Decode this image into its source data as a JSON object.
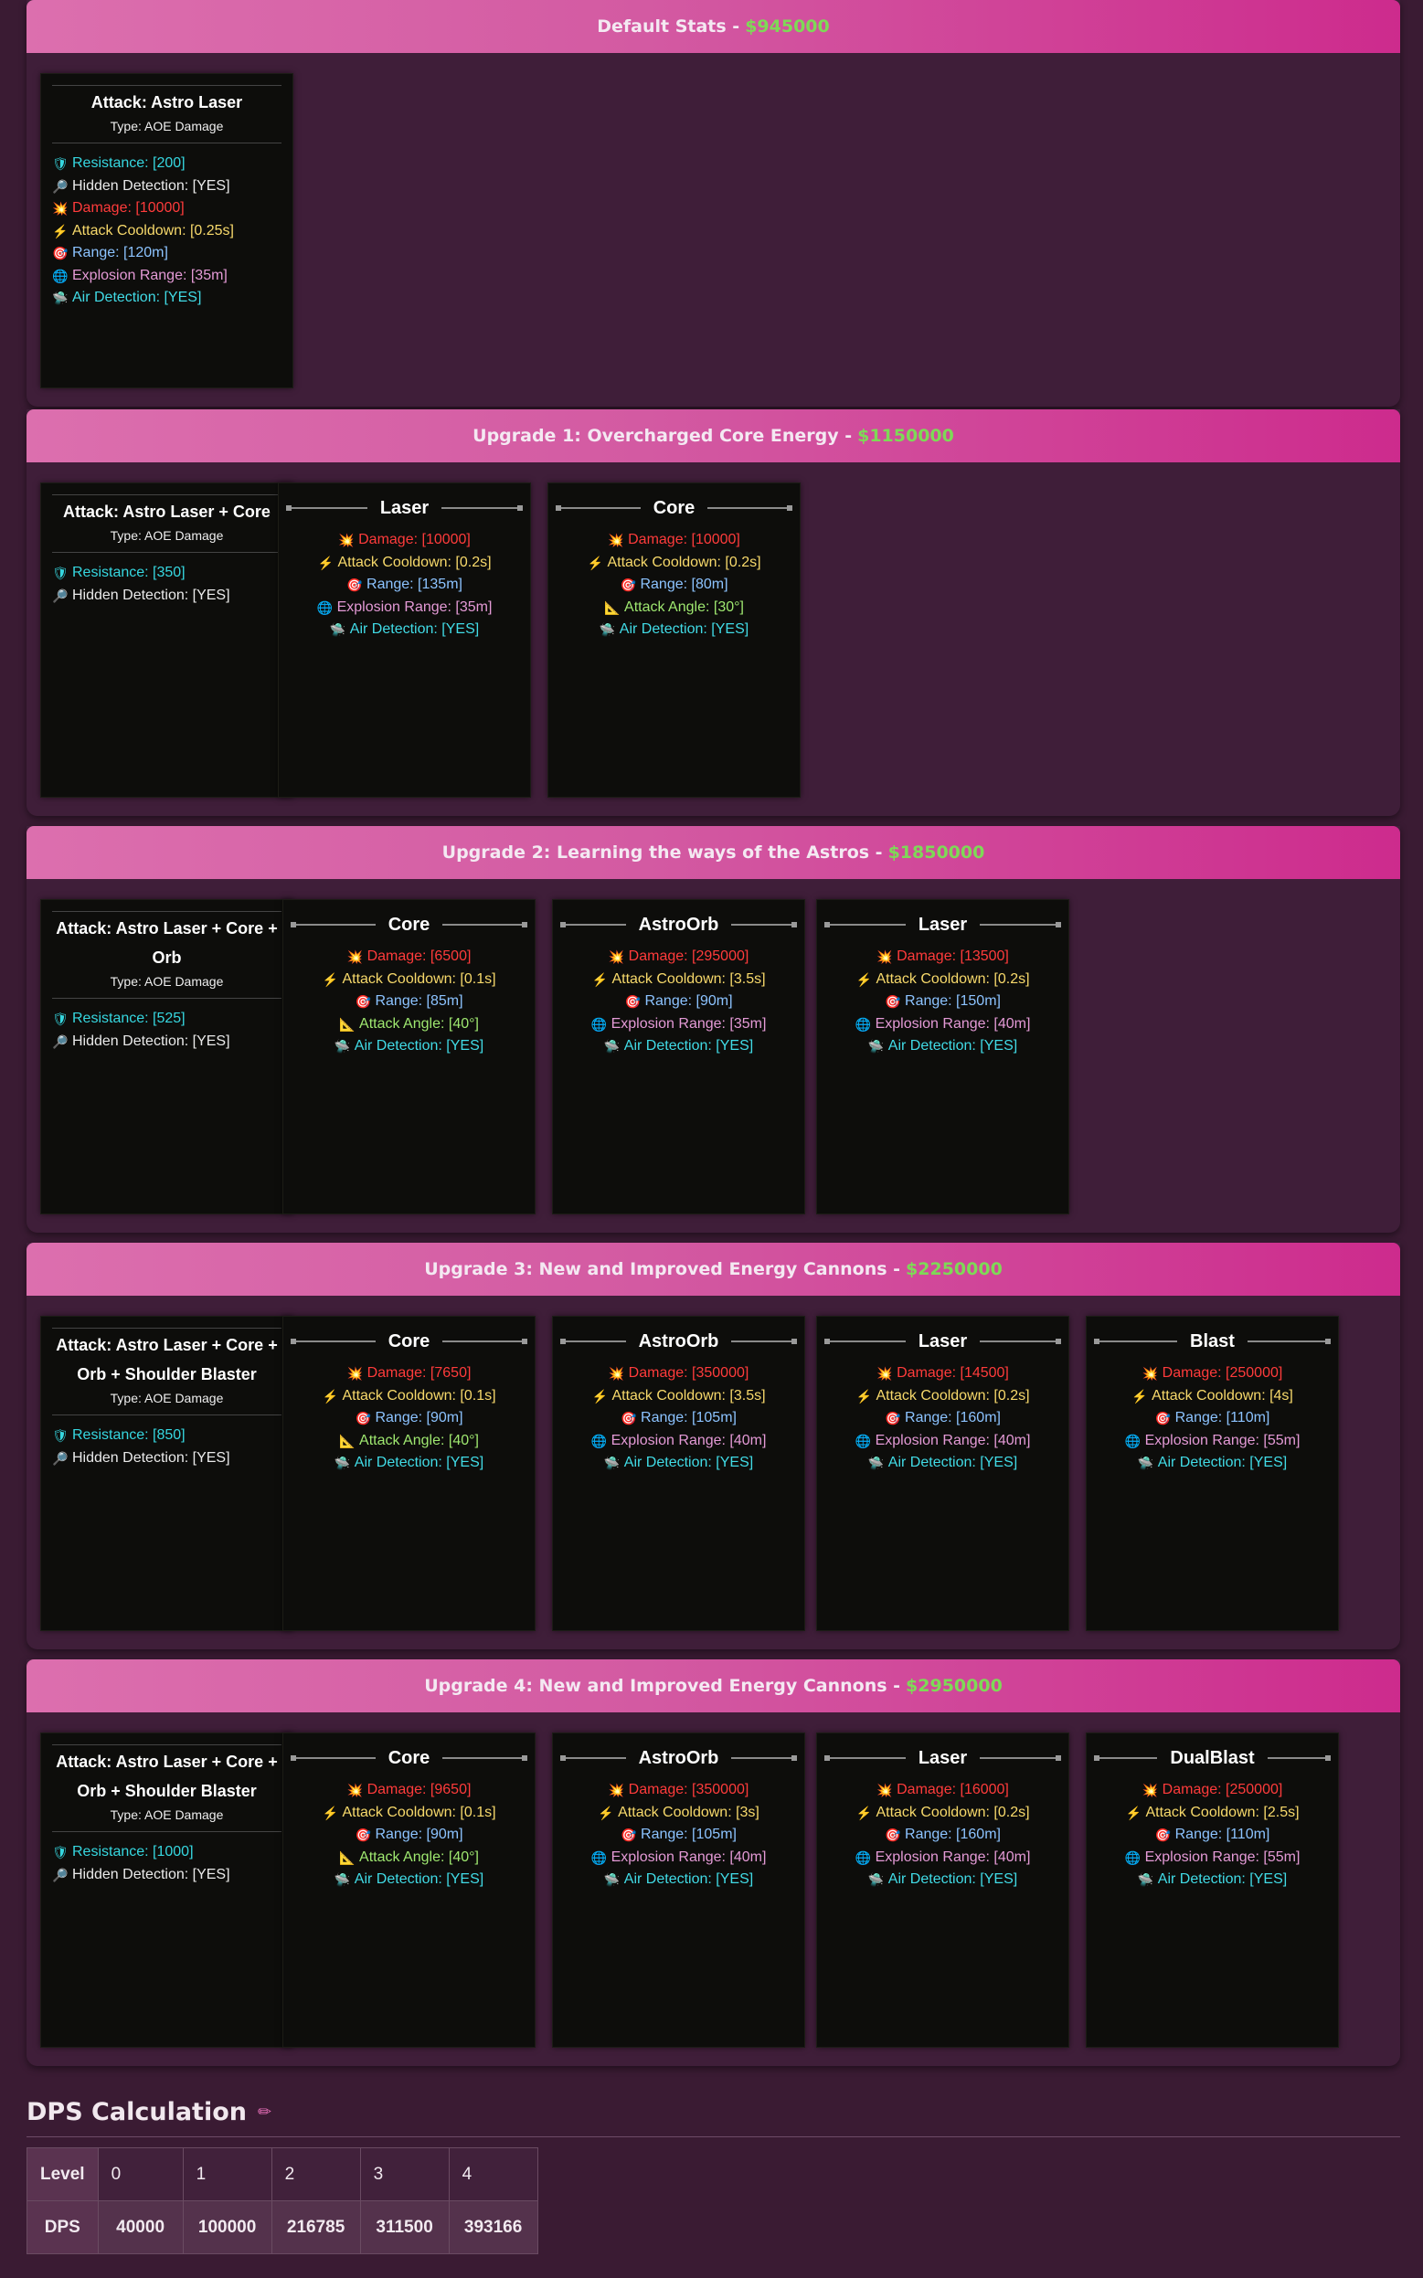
{
  "sections": [
    {
      "title": "Default Stats - ",
      "price": "$945000",
      "main": {
        "title": "Attack: Astro Laser",
        "type": "Type: AOE Damage",
        "stats": [
          {
            "icon": "shield-icon",
            "glyph": "🛡",
            "cls": "c-res",
            "text": "Resistance: [200]"
          },
          {
            "icon": "magnifier-icon",
            "glyph": "🔎",
            "cls": "c-hid",
            "text": "Hidden Detection: [YES]"
          },
          {
            "icon": "explosion-icon",
            "glyph": "💥",
            "cls": "c-dmg",
            "text": "Damage: [10000]"
          },
          {
            "icon": "lightning-icon",
            "glyph": "⚡",
            "cls": "c-cd",
            "text": "Attack Cooldown: [0.25s]"
          },
          {
            "icon": "target-icon",
            "glyph": "🎯",
            "cls": "c-rng",
            "text": "Range: [120m]"
          },
          {
            "icon": "globe-icon",
            "glyph": "🌐",
            "cls": "c-exp",
            "text": "Explosion Range: [35m]"
          },
          {
            "icon": "ufo-icon",
            "glyph": "🛸",
            "cls": "c-air",
            "text": "Air Detection: [YES]"
          }
        ]
      },
      "subs": []
    },
    {
      "title": "Upgrade 1: Overcharged Core Energy - ",
      "price": "$1150000",
      "main": {
        "title": "Attack: Astro Laser + Core",
        "type": "Type: AOE Damage",
        "stats": [
          {
            "icon": "shield-icon",
            "glyph": "🛡",
            "cls": "c-res",
            "text": "Resistance: [350]"
          },
          {
            "icon": "magnifier-icon",
            "glyph": "🔎",
            "cls": "c-hid",
            "text": "Hidden Detection: [YES]"
          }
        ]
      },
      "subs": [
        {
          "name": "Laser",
          "stats": [
            {
              "icon": "explosion-icon",
              "glyph": "💥",
              "cls": "c-dmg",
              "text": "Damage: [10000]"
            },
            {
              "icon": "lightning-icon",
              "glyph": "⚡",
              "cls": "c-cd",
              "text": "Attack Cooldown: [0.2s]"
            },
            {
              "icon": "target-icon",
              "glyph": "🎯",
              "cls": "c-rng",
              "text": "Range: [135m]"
            },
            {
              "icon": "globe-icon",
              "glyph": "🌐",
              "cls": "c-exp",
              "text": "Explosion Range: [35m]"
            },
            {
              "icon": "ufo-icon",
              "glyph": "🛸",
              "cls": "c-air",
              "text": "Air Detection: [YES]"
            }
          ]
        },
        {
          "name": "Core",
          "stats": [
            {
              "icon": "explosion-icon",
              "glyph": "💥",
              "cls": "c-dmg",
              "text": "Damage: [10000]"
            },
            {
              "icon": "lightning-icon",
              "glyph": "⚡",
              "cls": "c-cd",
              "text": "Attack Cooldown: [0.2s]"
            },
            {
              "icon": "target-icon",
              "glyph": "🎯",
              "cls": "c-rng",
              "text": "Range: [80m]"
            },
            {
              "icon": "triangle-ruler-icon",
              "glyph": "📐",
              "cls": "c-ang",
              "text": "Attack Angle: [30°]"
            },
            {
              "icon": "ufo-icon",
              "glyph": "🛸",
              "cls": "c-air",
              "text": "Air Detection: [YES]"
            }
          ]
        }
      ]
    },
    {
      "title": "Upgrade 2: Learning the ways of the Astros - ",
      "price": "$1850000",
      "main": {
        "title": "Attack: Astro Laser + Core + Orb",
        "type": "Type: AOE Damage",
        "stats": [
          {
            "icon": "shield-icon",
            "glyph": "🛡",
            "cls": "c-res",
            "text": "Resistance: [525]"
          },
          {
            "icon": "magnifier-icon",
            "glyph": "🔎",
            "cls": "c-hid",
            "text": "Hidden Detection: [YES]"
          }
        ]
      },
      "subs": [
        {
          "name": "Core",
          "stats": [
            {
              "icon": "explosion-icon",
              "glyph": "💥",
              "cls": "c-dmg",
              "text": "Damage: [6500]"
            },
            {
              "icon": "lightning-icon",
              "glyph": "⚡",
              "cls": "c-cd",
              "text": "Attack Cooldown: [0.1s]"
            },
            {
              "icon": "target-icon",
              "glyph": "🎯",
              "cls": "c-rng",
              "text": "Range: [85m]"
            },
            {
              "icon": "triangle-ruler-icon",
              "glyph": "📐",
              "cls": "c-ang",
              "text": "Attack Angle: [40°]"
            },
            {
              "icon": "ufo-icon",
              "glyph": "🛸",
              "cls": "c-air",
              "text": "Air Detection: [YES]"
            }
          ]
        },
        {
          "name": "AstroOrb",
          "stats": [
            {
              "icon": "explosion-icon",
              "glyph": "💥",
              "cls": "c-dmg",
              "text": "Damage: [295000]"
            },
            {
              "icon": "lightning-icon",
              "glyph": "⚡",
              "cls": "c-cd",
              "text": "Attack Cooldown: [3.5s]"
            },
            {
              "icon": "target-icon",
              "glyph": "🎯",
              "cls": "c-rng",
              "text": "Range: [90m]"
            },
            {
              "icon": "globe-icon",
              "glyph": "🌐",
              "cls": "c-exp",
              "text": "Explosion Range: [35m]"
            },
            {
              "icon": "ufo-icon",
              "glyph": "🛸",
              "cls": "c-air",
              "text": "Air Detection: [YES]"
            }
          ]
        },
        {
          "name": "Laser",
          "stats": [
            {
              "icon": "explosion-icon",
              "glyph": "💥",
              "cls": "c-dmg",
              "text": "Damage: [13500]"
            },
            {
              "icon": "lightning-icon",
              "glyph": "⚡",
              "cls": "c-cd",
              "text": "Attack Cooldown: [0.2s]"
            },
            {
              "icon": "target-icon",
              "glyph": "🎯",
              "cls": "c-rng",
              "text": "Range: [150m]"
            },
            {
              "icon": "globe-icon",
              "glyph": "🌐",
              "cls": "c-exp",
              "text": "Explosion Range: [40m]"
            },
            {
              "icon": "ufo-icon",
              "glyph": "🛸",
              "cls": "c-air",
              "text": "Air Detection: [YES]"
            }
          ]
        }
      ]
    },
    {
      "title": "Upgrade 3: New and Improved Energy Cannons - ",
      "price": "$2250000",
      "main": {
        "title": "Attack: Astro Laser + Core + Orb + Shoulder Blaster",
        "type": "Type: AOE Damage",
        "stats": [
          {
            "icon": "shield-icon",
            "glyph": "🛡",
            "cls": "c-res",
            "text": "Resistance: [850]"
          },
          {
            "icon": "magnifier-icon",
            "glyph": "🔎",
            "cls": "c-hid",
            "text": "Hidden Detection: [YES]"
          }
        ]
      },
      "subs": [
        {
          "name": "Core",
          "stats": [
            {
              "icon": "explosion-icon",
              "glyph": "💥",
              "cls": "c-dmg",
              "text": "Damage: [7650]"
            },
            {
              "icon": "lightning-icon",
              "glyph": "⚡",
              "cls": "c-cd",
              "text": "Attack Cooldown: [0.1s]"
            },
            {
              "icon": "target-icon",
              "glyph": "🎯",
              "cls": "c-rng",
              "text": "Range: [90m]"
            },
            {
              "icon": "triangle-ruler-icon",
              "glyph": "📐",
              "cls": "c-ang",
              "text": "Attack Angle: [40°]"
            },
            {
              "icon": "ufo-icon",
              "glyph": "🛸",
              "cls": "c-air",
              "text": "Air Detection: [YES]"
            }
          ]
        },
        {
          "name": "AstroOrb",
          "stats": [
            {
              "icon": "explosion-icon",
              "glyph": "💥",
              "cls": "c-dmg",
              "text": "Damage: [350000]"
            },
            {
              "icon": "lightning-icon",
              "glyph": "⚡",
              "cls": "c-cd",
              "text": "Attack Cooldown: [3.5s]"
            },
            {
              "icon": "target-icon",
              "glyph": "🎯",
              "cls": "c-rng",
              "text": "Range: [105m]"
            },
            {
              "icon": "globe-icon",
              "glyph": "🌐",
              "cls": "c-exp",
              "text": "Explosion Range: [40m]"
            },
            {
              "icon": "ufo-icon",
              "glyph": "🛸",
              "cls": "c-air",
              "text": "Air Detection: [YES]"
            }
          ]
        },
        {
          "name": "Laser",
          "stats": [
            {
              "icon": "explosion-icon",
              "glyph": "💥",
              "cls": "c-dmg",
              "text": "Damage: [14500]"
            },
            {
              "icon": "lightning-icon",
              "glyph": "⚡",
              "cls": "c-cd",
              "text": "Attack Cooldown: [0.2s]"
            },
            {
              "icon": "target-icon",
              "glyph": "🎯",
              "cls": "c-rng",
              "text": "Range: [160m]"
            },
            {
              "icon": "globe-icon",
              "glyph": "🌐",
              "cls": "c-exp",
              "text": "Explosion Range: [40m]"
            },
            {
              "icon": "ufo-icon",
              "glyph": "🛸",
              "cls": "c-air",
              "text": "Air Detection: [YES]"
            }
          ]
        },
        {
          "name": "Blast",
          "stats": [
            {
              "icon": "explosion-icon",
              "glyph": "💥",
              "cls": "c-dmg",
              "text": "Damage: [250000]"
            },
            {
              "icon": "lightning-icon",
              "glyph": "⚡",
              "cls": "c-cd",
              "text": "Attack Cooldown: [4s]"
            },
            {
              "icon": "target-icon",
              "glyph": "🎯",
              "cls": "c-rng",
              "text": "Range: [110m]"
            },
            {
              "icon": "globe-icon",
              "glyph": "🌐",
              "cls": "c-exp",
              "text": "Explosion Range: [55m]"
            },
            {
              "icon": "ufo-icon",
              "glyph": "🛸",
              "cls": "c-air",
              "text": "Air Detection: [YES]"
            }
          ]
        }
      ]
    },
    {
      "title": "Upgrade 4: New and Improved Energy Cannons - ",
      "price": "$2950000",
      "main": {
        "title": "Attack: Astro Laser + Core + Orb + Shoulder Blaster",
        "type": "Type: AOE Damage",
        "stats": [
          {
            "icon": "shield-icon",
            "glyph": "🛡",
            "cls": "c-res",
            "text": "Resistance: [1000]"
          },
          {
            "icon": "magnifier-icon",
            "glyph": "🔎",
            "cls": "c-hid",
            "text": "Hidden Detection: [YES]"
          }
        ]
      },
      "subs": [
        {
          "name": "Core",
          "stats": [
            {
              "icon": "explosion-icon",
              "glyph": "💥",
              "cls": "c-dmg",
              "text": "Damage: [9650]"
            },
            {
              "icon": "lightning-icon",
              "glyph": "⚡",
              "cls": "c-cd",
              "text": "Attack Cooldown: [0.1s]"
            },
            {
              "icon": "target-icon",
              "glyph": "🎯",
              "cls": "c-rng",
              "text": "Range: [90m]"
            },
            {
              "icon": "triangle-ruler-icon",
              "glyph": "📐",
              "cls": "c-ang",
              "text": "Attack Angle: [40°]"
            },
            {
              "icon": "ufo-icon",
              "glyph": "🛸",
              "cls": "c-air",
              "text": "Air Detection: [YES]"
            }
          ]
        },
        {
          "name": "AstroOrb",
          "stats": [
            {
              "icon": "explosion-icon",
              "glyph": "💥",
              "cls": "c-dmg",
              "text": "Damage: [350000]"
            },
            {
              "icon": "lightning-icon",
              "glyph": "⚡",
              "cls": "c-cd",
              "text": "Attack Cooldown: [3s]"
            },
            {
              "icon": "target-icon",
              "glyph": "🎯",
              "cls": "c-rng",
              "text": "Range: [105m]"
            },
            {
              "icon": "globe-icon",
              "glyph": "🌐",
              "cls": "c-exp",
              "text": "Explosion Range: [40m]"
            },
            {
              "icon": "ufo-icon",
              "glyph": "🛸",
              "cls": "c-air",
              "text": "Air Detection: [YES]"
            }
          ]
        },
        {
          "name": "Laser",
          "stats": [
            {
              "icon": "explosion-icon",
              "glyph": "💥",
              "cls": "c-dmg",
              "text": "Damage: [16000]"
            },
            {
              "icon": "lightning-icon",
              "glyph": "⚡",
              "cls": "c-cd",
              "text": "Attack Cooldown: [0.2s]"
            },
            {
              "icon": "target-icon",
              "glyph": "🎯",
              "cls": "c-rng",
              "text": "Range: [160m]"
            },
            {
              "icon": "globe-icon",
              "glyph": "🌐",
              "cls": "c-exp",
              "text": "Explosion Range: [40m]"
            },
            {
              "icon": "ufo-icon",
              "glyph": "🛸",
              "cls": "c-air",
              "text": "Air Detection: [YES]"
            }
          ]
        },
        {
          "name": "DualBlast",
          "stats": [
            {
              "icon": "explosion-icon",
              "glyph": "💥",
              "cls": "c-dmg",
              "text": "Damage: [250000]"
            },
            {
              "icon": "lightning-icon",
              "glyph": "⚡",
              "cls": "c-cd",
              "text": "Attack Cooldown: [2.5s]"
            },
            {
              "icon": "target-icon",
              "glyph": "🎯",
              "cls": "c-rng",
              "text": "Range: [110m]"
            },
            {
              "icon": "globe-icon",
              "glyph": "🌐",
              "cls": "c-exp",
              "text": "Explosion Range: [55m]"
            },
            {
              "icon": "ufo-icon",
              "glyph": "🛸",
              "cls": "c-air",
              "text": "Air Detection: [YES]"
            }
          ]
        }
      ]
    }
  ],
  "dps": {
    "title": "DPS Calculation",
    "row1_label": "Level",
    "row2_label": "DPS",
    "levels": [
      "0",
      "1",
      "2",
      "3",
      "4"
    ],
    "values": [
      "40000",
      "100000",
      "216785",
      "311500",
      "393166"
    ]
  },
  "colors": {
    "header_start": "#dc6fae",
    "header_end": "#cd2b8d",
    "price": "#7ed957",
    "background": "#3a1b33"
  }
}
